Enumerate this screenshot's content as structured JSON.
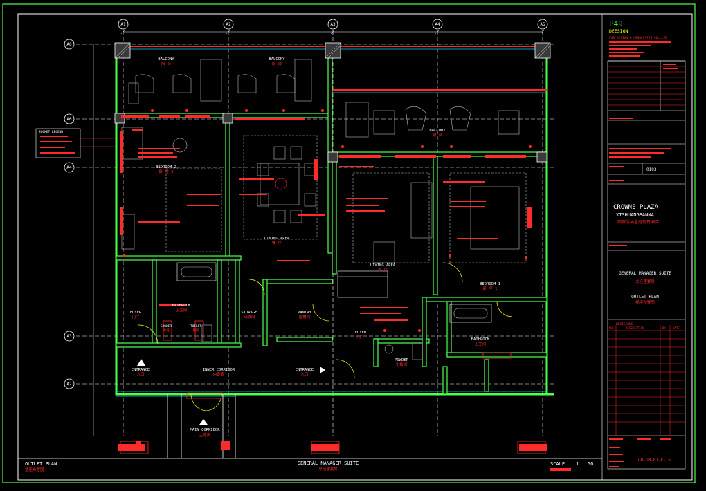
{
  "drawing": {
    "grid_labels": {
      "cols": [
        "A1",
        "A2",
        "A3",
        "A4",
        "A5"
      ],
      "rows": [
        "A6",
        "A6",
        "A4",
        "A3",
        "A2"
      ]
    },
    "rooms": {
      "balcony_left": {
        "en": "BALCONY",
        "cn": "阳 台"
      },
      "balcony_mid": {
        "en": "BALCONY",
        "cn": "阳 台"
      },
      "balcony_right": {
        "en": "BALCONY",
        "cn": "阳 台"
      },
      "bedroom2": {
        "en": "BEDROOM 2",
        "cn": "卧 室 2"
      },
      "dining": {
        "en": "DINING AREA",
        "cn": "餐 厅"
      },
      "living": {
        "en": "LIVING AREA",
        "cn": "客 厅"
      },
      "bedroom1": {
        "en": "BEDROOM 1",
        "cn": "卧 室 1"
      },
      "foyer_left": {
        "en": "FOYER",
        "cn": "门厅"
      },
      "bathroom_left": {
        "en": "BATHROOM",
        "cn": "卫生间"
      },
      "shower": {
        "en": "SHOWER",
        "cn": "淋浴"
      },
      "toilet": {
        "en": "TOILET",
        "cn": "厕所"
      },
      "storage": {
        "en": "STORAGE",
        "cn": "储藏间"
      },
      "pantry": {
        "en": "PANTRY",
        "cn": "备餐间"
      },
      "foyer_right": {
        "en": "FOYER",
        "cn": "门厅"
      },
      "powder": {
        "en": "POWDER",
        "cn": "化妆间"
      },
      "bathroom_right": {
        "en": "BATHROOM",
        "cn": "卫生间"
      },
      "entrance_left": {
        "en": "ENTRANCE",
        "cn": "入口"
      },
      "inner_corridor": {
        "en": "INNER CORRIDOR",
        "cn": "内走廊"
      },
      "entrance_right": {
        "en": "ENTRANCE",
        "cn": "入口"
      },
      "main_corridor": {
        "en": "MAIN CORRIDOR",
        "cn": "主走廊"
      }
    },
    "legend_title": "SOCKET LEGEND",
    "bottom_bar": {
      "left_en": "OUTLET PLAN",
      "left_cn": "插座布置图",
      "center_en": "GENERAL MANAGER SUITE",
      "center_cn": "总经理套房",
      "scale_label": "SCALE",
      "scale_value": "1 : 50"
    }
  },
  "title_block": {
    "firm": "P49",
    "firm_sub": "DEESIGN",
    "firm_line": "P49 DESIGN & ASSOCIATES CO.,LTD",
    "project_en1": "CROWNE PLAZA",
    "project_en2": "XISHUANGBANNA",
    "project_cn": "西双版纳皇冠假日酒店",
    "sheet_title1": "GENERAL MANAGER SUITE",
    "sheet_title1_cn": "总经理套房",
    "sheet_title2": "OUTLET PLAN",
    "sheet_title2_cn": "插座布置图",
    "revision_no": "0103",
    "drawing_no": "DD-GM-01-E-16",
    "revisions_header": "REVISIONS",
    "revision_cols": [
      "NO.",
      "DESCRIPTION",
      "BY",
      "DATE"
    ]
  },
  "colors": {
    "background": "#000000",
    "wall": "#4cff4c",
    "annotation": "#ff2a2a",
    "text": "#ffffff",
    "frame": "#4cff4c",
    "accent": "#ffff00",
    "cyan": "#00d8ff"
  }
}
